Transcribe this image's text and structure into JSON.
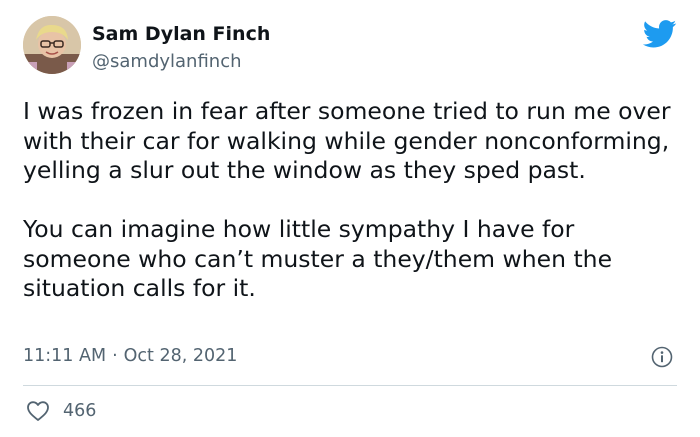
{
  "author": {
    "display_name": "Sam Dylan Finch",
    "handle": "@samdylanfinch"
  },
  "tweet": {
    "paragraphs": [
      "I was frozen in fear after someone tried to run me over with their car for walking while gender nonconforming, yelling a slur out the window as they sped past.",
      "You can imagine how little sympathy I have for someone who can’t muster a they/them when the situation calls for it."
    ],
    "time": "11:11 AM",
    "separator": "·",
    "date": "Oct 28, 2021",
    "like_count": "466"
  },
  "icons": {
    "brand": "twitter-bird-icon",
    "info": "info-icon",
    "like": "heart-icon"
  },
  "colors": {
    "brand_blue": "#1d9bf0",
    "secondary_text": "#536471",
    "primary_text": "#0f1419",
    "divider": "#cfd9de"
  }
}
